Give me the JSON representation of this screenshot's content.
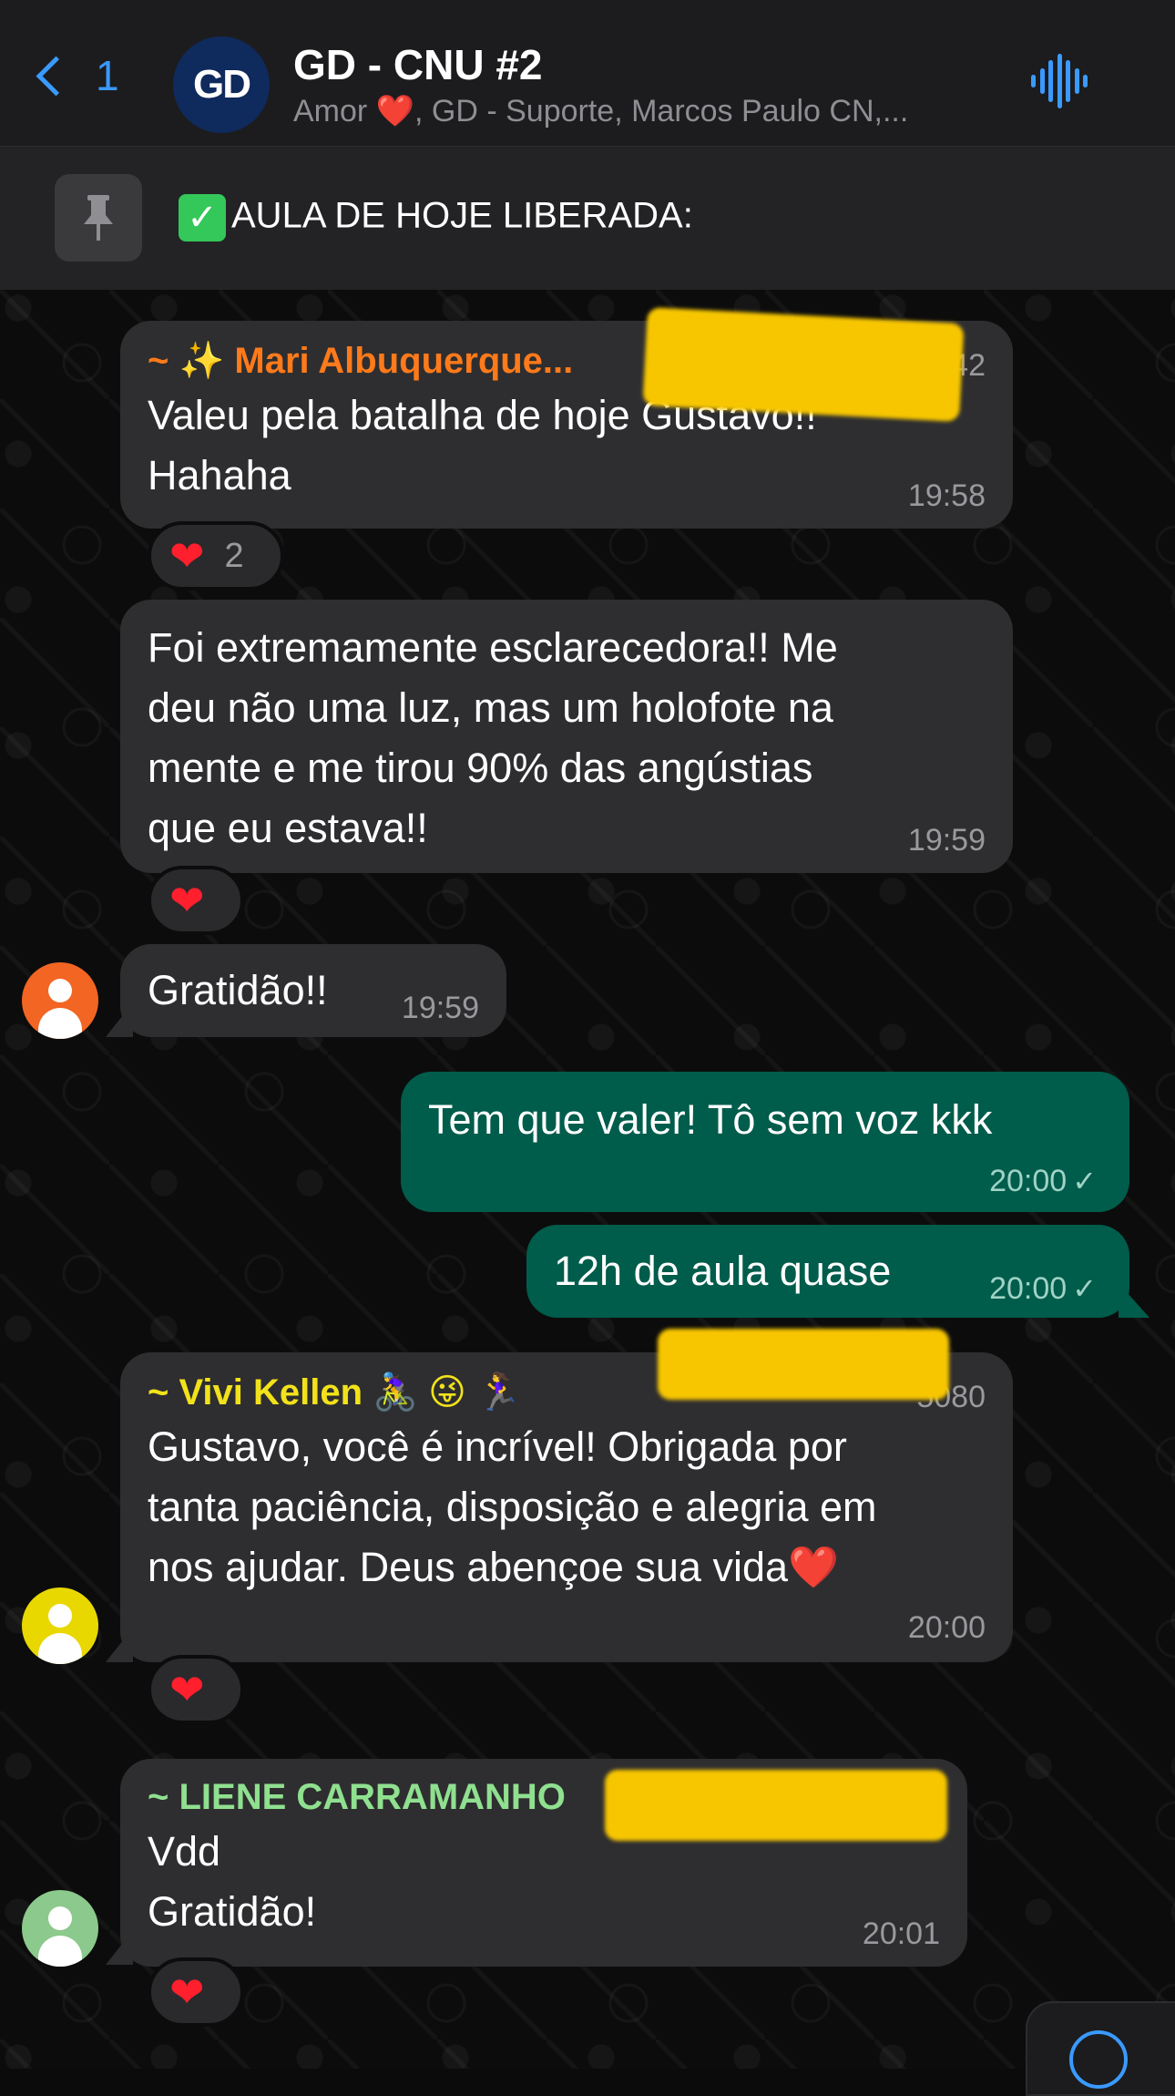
{
  "header": {
    "back_count": "1",
    "avatar_text": "GD",
    "title": "GD - CNU #2",
    "subtitle": "Amor ❤️, GD - Suporte, Marcos Paulo CN,..."
  },
  "pinned": {
    "emoji": "✓",
    "text": "AULA DE HOJE LIBERADA:"
  },
  "messages": [
    {
      "sender": "~ ✨ Mari Albuquerque...",
      "sender_suffix": "42",
      "text_lines": [
        "Valeu pela batalha de hoje Gustavo!!",
        "Hahaha"
      ],
      "time": "19:58",
      "reaction_count": "2"
    },
    {
      "text_lines": [
        "Foi extremamente esclarecedora!! Me",
        "deu não uma luz, mas um holofote na",
        "mente e me tirou 90% das angústias",
        "que eu estava!!"
      ],
      "time": "19:59"
    },
    {
      "text": "Gratidão!!",
      "time": "19:59"
    },
    {
      "text": "Tem que valer! Tô sem voz kkk",
      "time": "20:00"
    },
    {
      "text": "12h de aula quase",
      "time": "20:00"
    },
    {
      "sender": "~ Vivi Kellen",
      "sender_emojis": "🚴‍♀️ 😜 🏃‍♀️",
      "sender_suffix": "5080",
      "text_lines": [
        "Gustavo, você é incrível! Obrigada por",
        "tanta paciência, disposição e alegria em",
        "nos ajudar. Deus abençoe sua vida❤️"
      ],
      "time": "20:00"
    },
    {
      "sender": "~ LIENE CARRAMANHO",
      "text_lines": [
        "Vdd",
        "Gratidão!"
      ],
      "time": "20:01"
    }
  ],
  "colors": {
    "accent": "#3a9aff",
    "outgoing_bubble": "#005c4b",
    "incoming_bubble": "#2e2e30",
    "sender_mari": "#ff7a1a",
    "sender_vivi": "#f2e21a",
    "sender_liene": "#8fe08f",
    "avatar_orange": "#f26522",
    "avatar_yellow": "#e8d800",
    "avatar_green": "#8cc98c"
  },
  "icons": [
    "back-chevron-icon",
    "audio-wave-icon",
    "pin-icon",
    "heart-icon",
    "user-avatar-icon",
    "scroll-down-icon"
  ]
}
